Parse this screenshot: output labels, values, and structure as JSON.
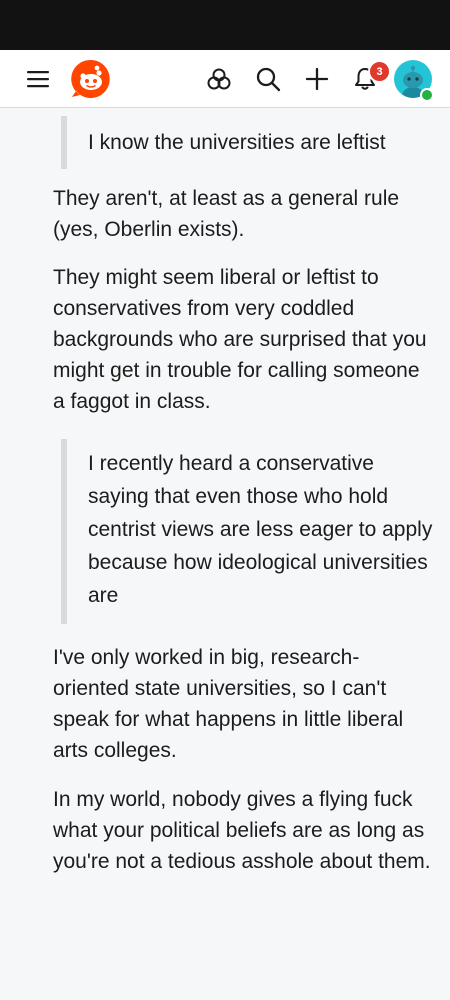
{
  "header": {
    "notification_count": "3",
    "icons": {
      "menu": "hamburger-menu-icon",
      "logo": "reddit-logo-icon",
      "communities": "communities-icon",
      "search": "search-icon",
      "create": "plus-icon",
      "notifications": "bell-icon",
      "avatar": "user-avatar"
    },
    "colors": {
      "brand": "#ff4500",
      "badge": "#e0382b",
      "avatar_bg": "#25c3d6",
      "online": "#21b243"
    }
  },
  "comment": {
    "quote1": "I know the universities are leftist",
    "para1": "They aren't, at least as a general rule (yes, Oberlin exists).",
    "para2": "They might seem liberal or leftist to conservatives from very coddled backgrounds who are surprised that you might get in trouble for calling someone a faggot in class.",
    "quote2": "I recently heard a conservative saying that even those who hold centrist views are less eager to apply because how ideological universities are",
    "para3": "I've only worked in big, research-oriented state universities, so I can't speak for what happens in little liberal arts colleges.",
    "para4": "In my world, nobody gives a flying fuck what your political beliefs are as long as you're not a tedious asshole about them."
  }
}
